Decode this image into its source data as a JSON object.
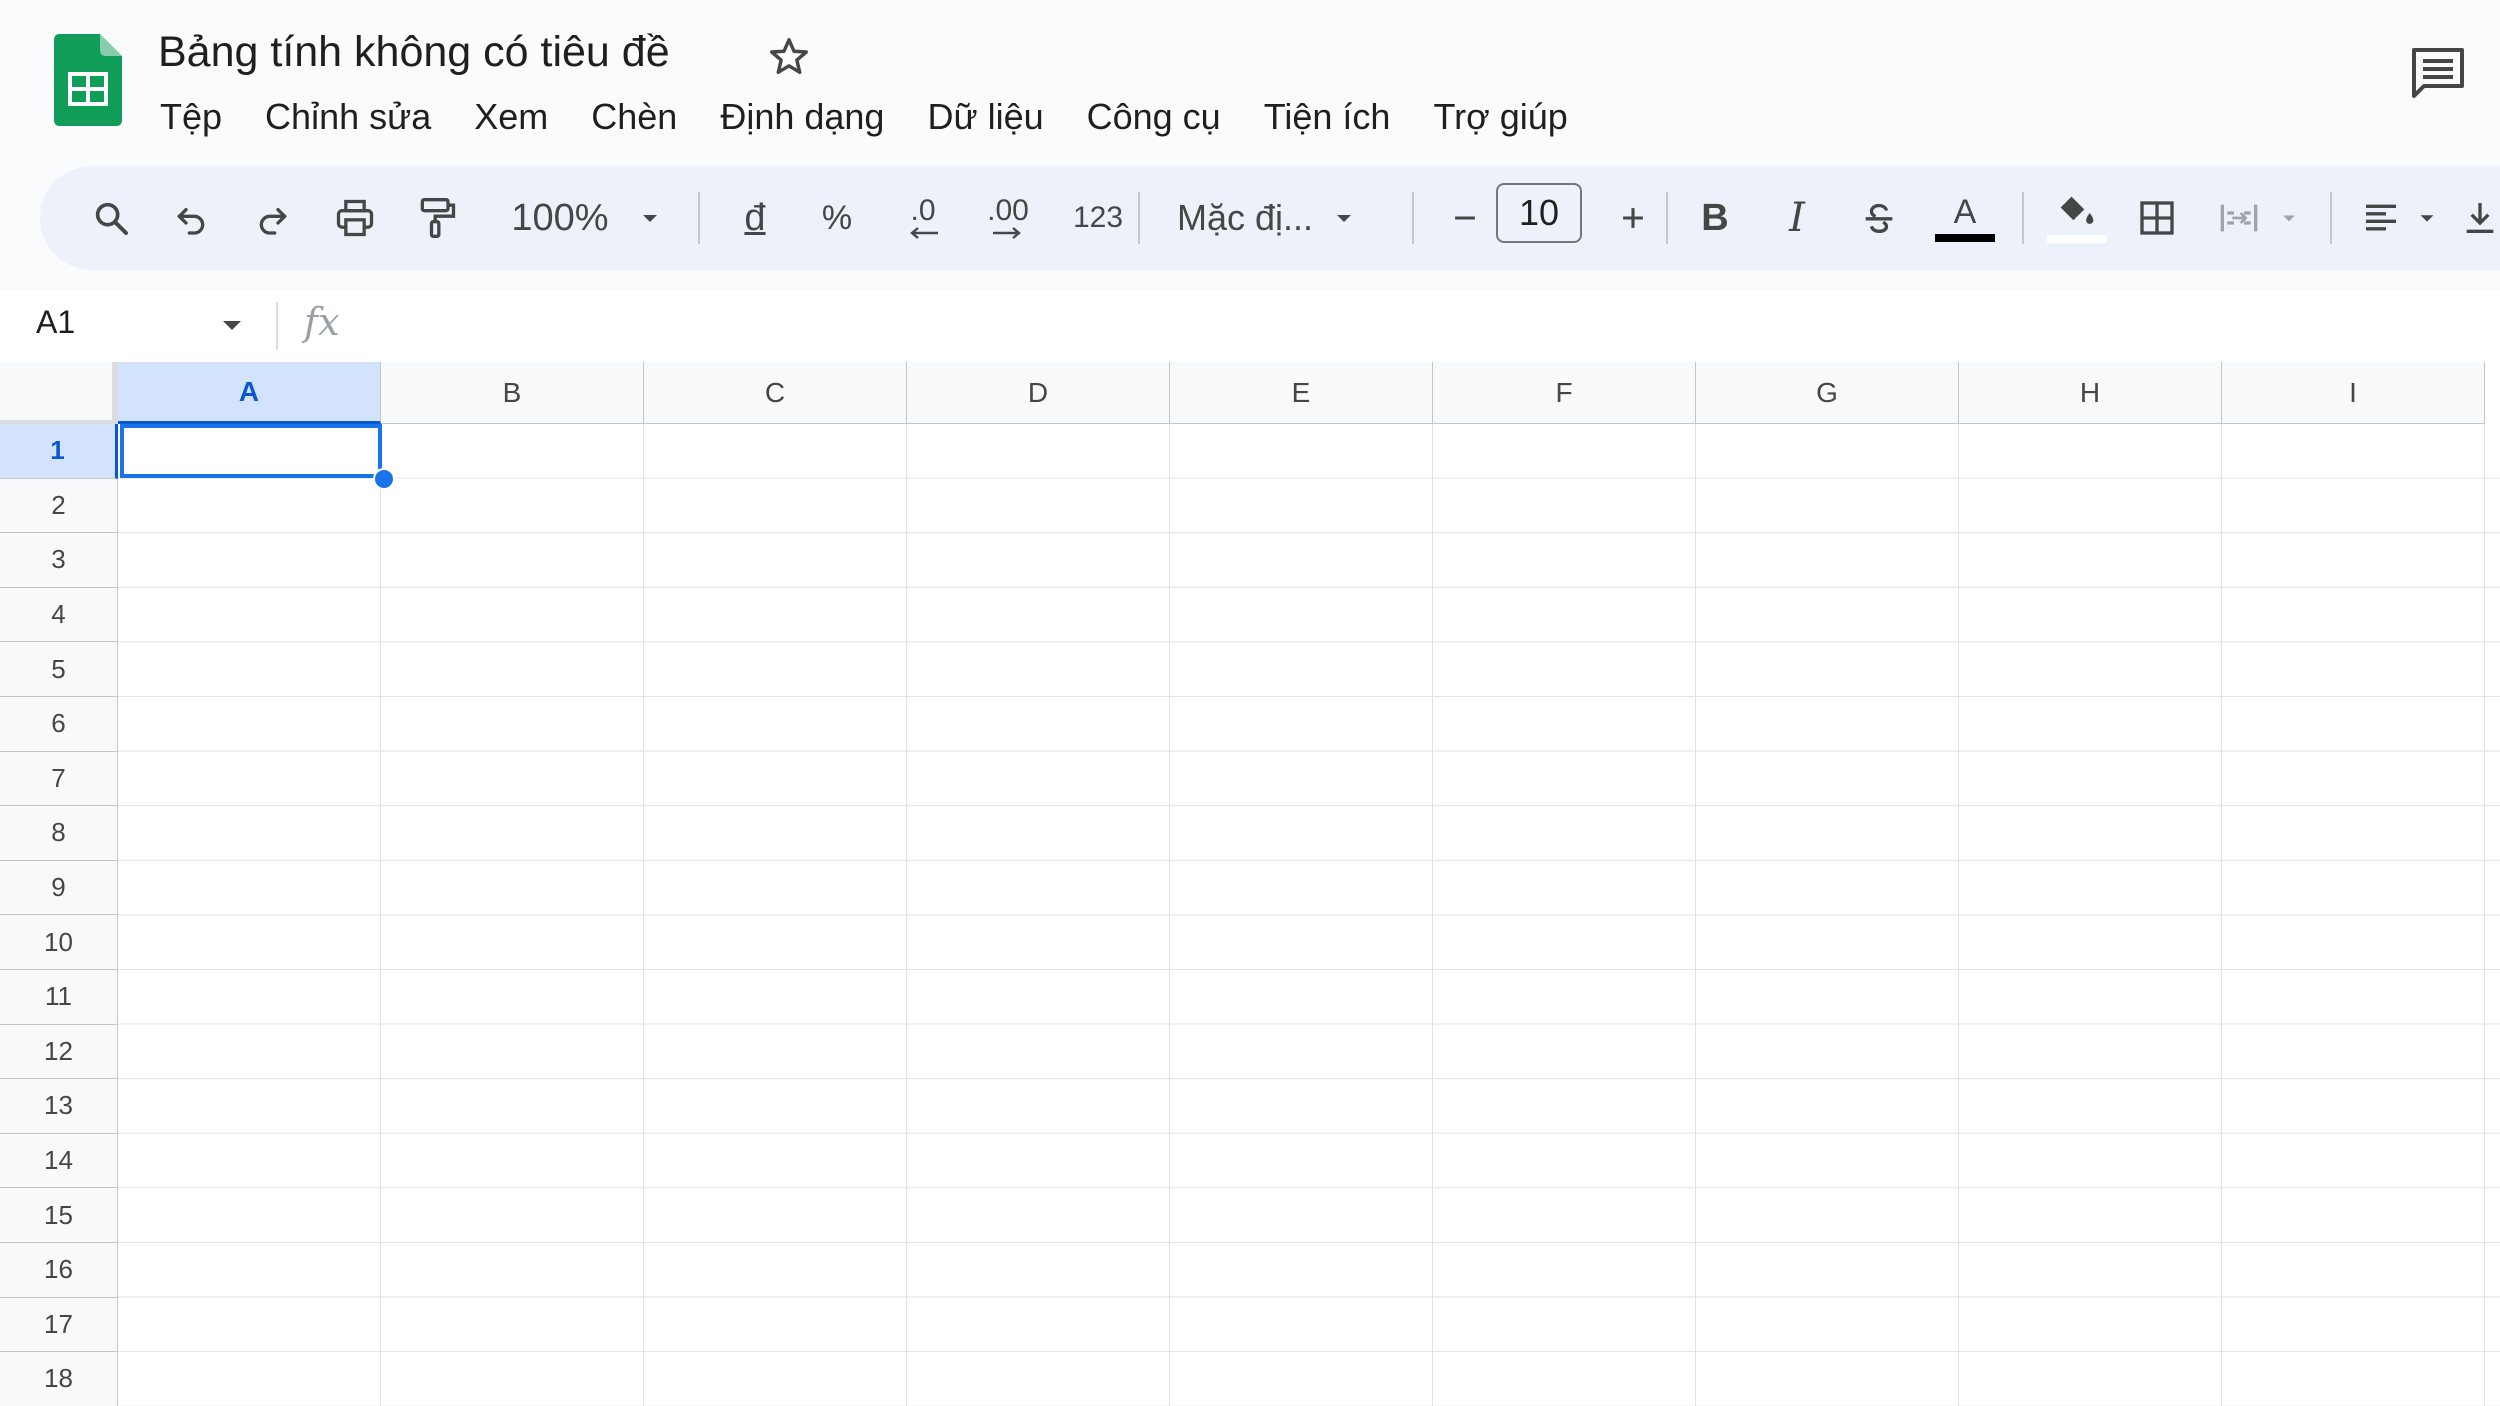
{
  "app": {
    "title": "Bảng tính không có tiêu đề",
    "brand_color": "#0f9d58"
  },
  "menu": [
    "Tệp",
    "Chỉnh sửa",
    "Xem",
    "Chèn",
    "Định dạng",
    "Dữ liệu",
    "Công cụ",
    "Tiện ích",
    "Trợ giúp"
  ],
  "toolbar": {
    "zoom": "100%",
    "currency": "đ",
    "percent": "%",
    "decrease_decimal": ".0",
    "increase_decimal": ".00",
    "number_format": "123",
    "font": "Mặc đị...",
    "font_size": "10",
    "text_color": "#000000"
  },
  "formula_bar": {
    "name_box": "A1",
    "fx": "fx",
    "value": ""
  },
  "grid": {
    "columns": [
      "A",
      "B",
      "C",
      "D",
      "E",
      "F",
      "G",
      "H",
      "I"
    ],
    "rows": [
      "1",
      "2",
      "3",
      "4",
      "5",
      "6",
      "7",
      "8",
      "9",
      "10",
      "11",
      "12",
      "13",
      "14",
      "15",
      "16",
      "17",
      "18"
    ],
    "selected_cell": "A1",
    "selection_color": "#1a73e8"
  }
}
